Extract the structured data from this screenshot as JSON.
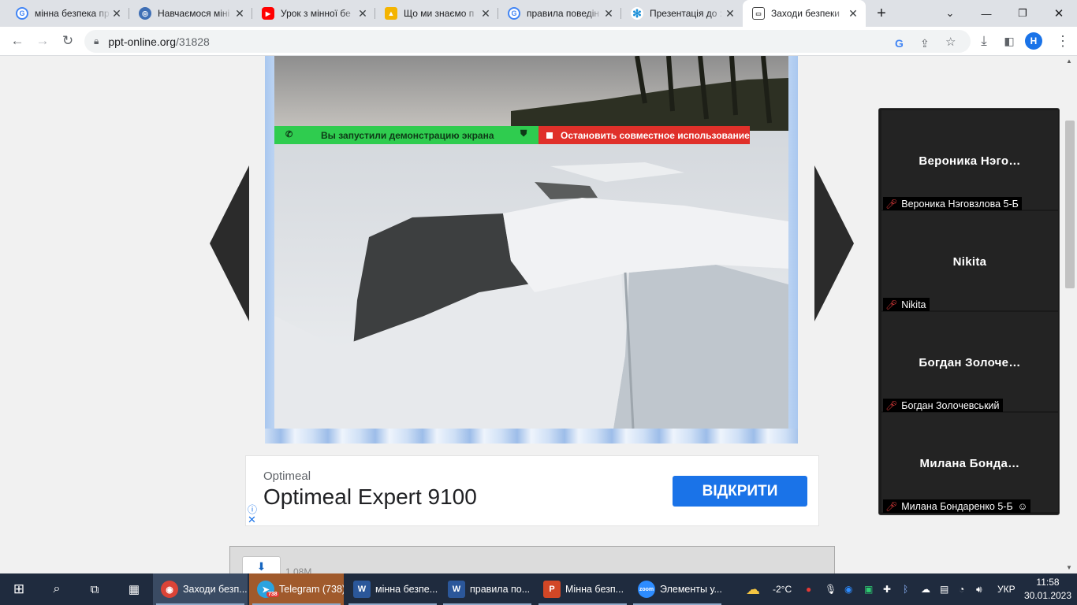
{
  "browser": {
    "tabs": [
      {
        "title": "мінна безпека пр",
        "icon": "google-icon"
      },
      {
        "title": "Навчаємося міні",
        "icon": "globe-icon"
      },
      {
        "title": "Урок з мінної бе",
        "icon": "youtube-icon"
      },
      {
        "title": "Що ми знаємо п",
        "icon": "bookmark-icon"
      },
      {
        "title": "правила поведін",
        "icon": "google-icon"
      },
      {
        "title": "Презентація до :",
        "icon": "snowflake-icon"
      },
      {
        "title": "Заходи безпеки",
        "icon": "slides-icon"
      }
    ],
    "new_tab": "+",
    "url_host": "ppt-online.org",
    "url_path": "/31828",
    "profile_initial": "H"
  },
  "share_banner": {
    "status": "Вы запустили демонстрацию экрана",
    "stop": "Остановить совместное использование"
  },
  "ad": {
    "brand": "Optimeal",
    "title": "Optimeal Expert 9100",
    "button": "ВІДКРИТИ"
  },
  "download": {
    "size": "1.08M"
  },
  "participants": [
    {
      "display": "Вероника  Нэго…",
      "label": "Вероника Нэговзлова 5-Б"
    },
    {
      "display": "Nikita",
      "label": "Nikita"
    },
    {
      "display": "Богдан  Золоче…",
      "label": "Богдан Золочевський"
    },
    {
      "display": "Милана  Бонда…",
      "label": "Милана Бондаренко 5-Б"
    }
  ],
  "taskbar": {
    "apps": [
      {
        "label": "Заходи безп...",
        "icon": "chrome-icon",
        "color": "#db4437"
      },
      {
        "label": "Telegram (738)",
        "icon": "telegram-icon",
        "color": "#2aa3df",
        "badge": "738"
      },
      {
        "label": "мінна безпе...",
        "icon": "word-icon",
        "color": "#2b579a"
      },
      {
        "label": "правила по...",
        "icon": "word-icon",
        "color": "#2b579a"
      },
      {
        "label": "Мінна безп...",
        "icon": "powerpoint-icon",
        "color": "#d24726"
      },
      {
        "label": "Элементы у...",
        "icon": "zoom-icon",
        "color": "#2d8cff"
      }
    ],
    "weather": "-2°C",
    "language": "УКР",
    "time": "11:58",
    "date": "30.01.2023"
  }
}
